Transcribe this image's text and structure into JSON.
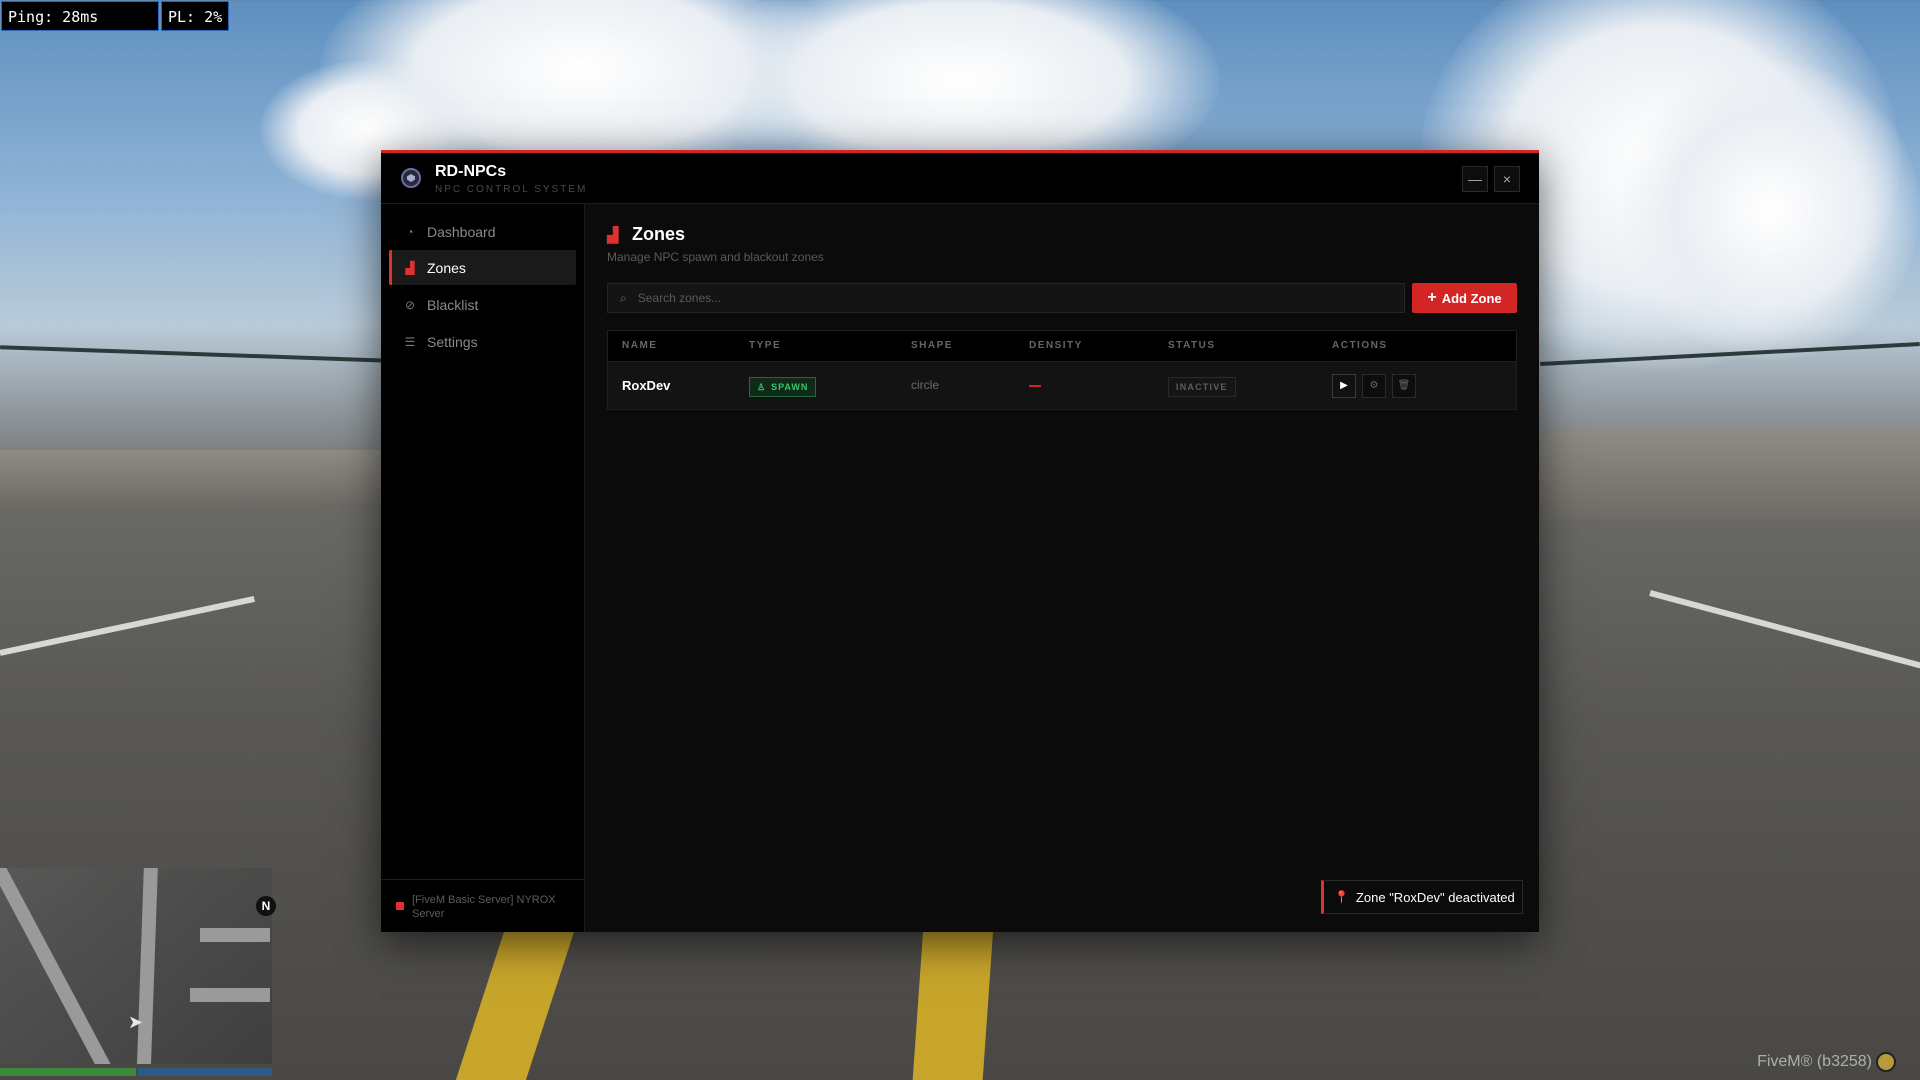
{
  "hud": {
    "ping": "Ping: 28ms",
    "packet_loss": "PL: 2%",
    "compass": "N",
    "client_version": "FiveM® (b3258)"
  },
  "app": {
    "title": "RD-NPCs",
    "subtitle": "NPC CONTROL SYSTEM",
    "minimize_label": "—",
    "close_label": "×",
    "accent_color": "#d42525"
  },
  "sidebar": {
    "items": [
      {
        "label": "Dashboard",
        "icon": "gauge-icon",
        "active": false
      },
      {
        "label": "Zones",
        "icon": "map-marker-icon",
        "active": true
      },
      {
        "label": "Blacklist",
        "icon": "ban-icon",
        "active": false
      },
      {
        "label": "Settings",
        "icon": "sliders-icon",
        "active": false
      }
    ],
    "footer_text": "[FiveM Basic Server] NYROX Server"
  },
  "main": {
    "title": "Zones",
    "subtitle": "Manage NPC spawn and blackout zones",
    "search_placeholder": "Search zones...",
    "add_button_label": "Add Zone"
  },
  "table": {
    "headers": [
      "NAME",
      "TYPE",
      "SHAPE",
      "DENSITY",
      "STATUS",
      "ACTIONS"
    ],
    "rows": [
      {
        "name": "RoxDev",
        "type": "SPAWN",
        "shape": "circle",
        "density": "",
        "status": "INACTIVE"
      }
    ]
  },
  "toast": {
    "message": "Zone \"RoxDev\" deactivated"
  }
}
